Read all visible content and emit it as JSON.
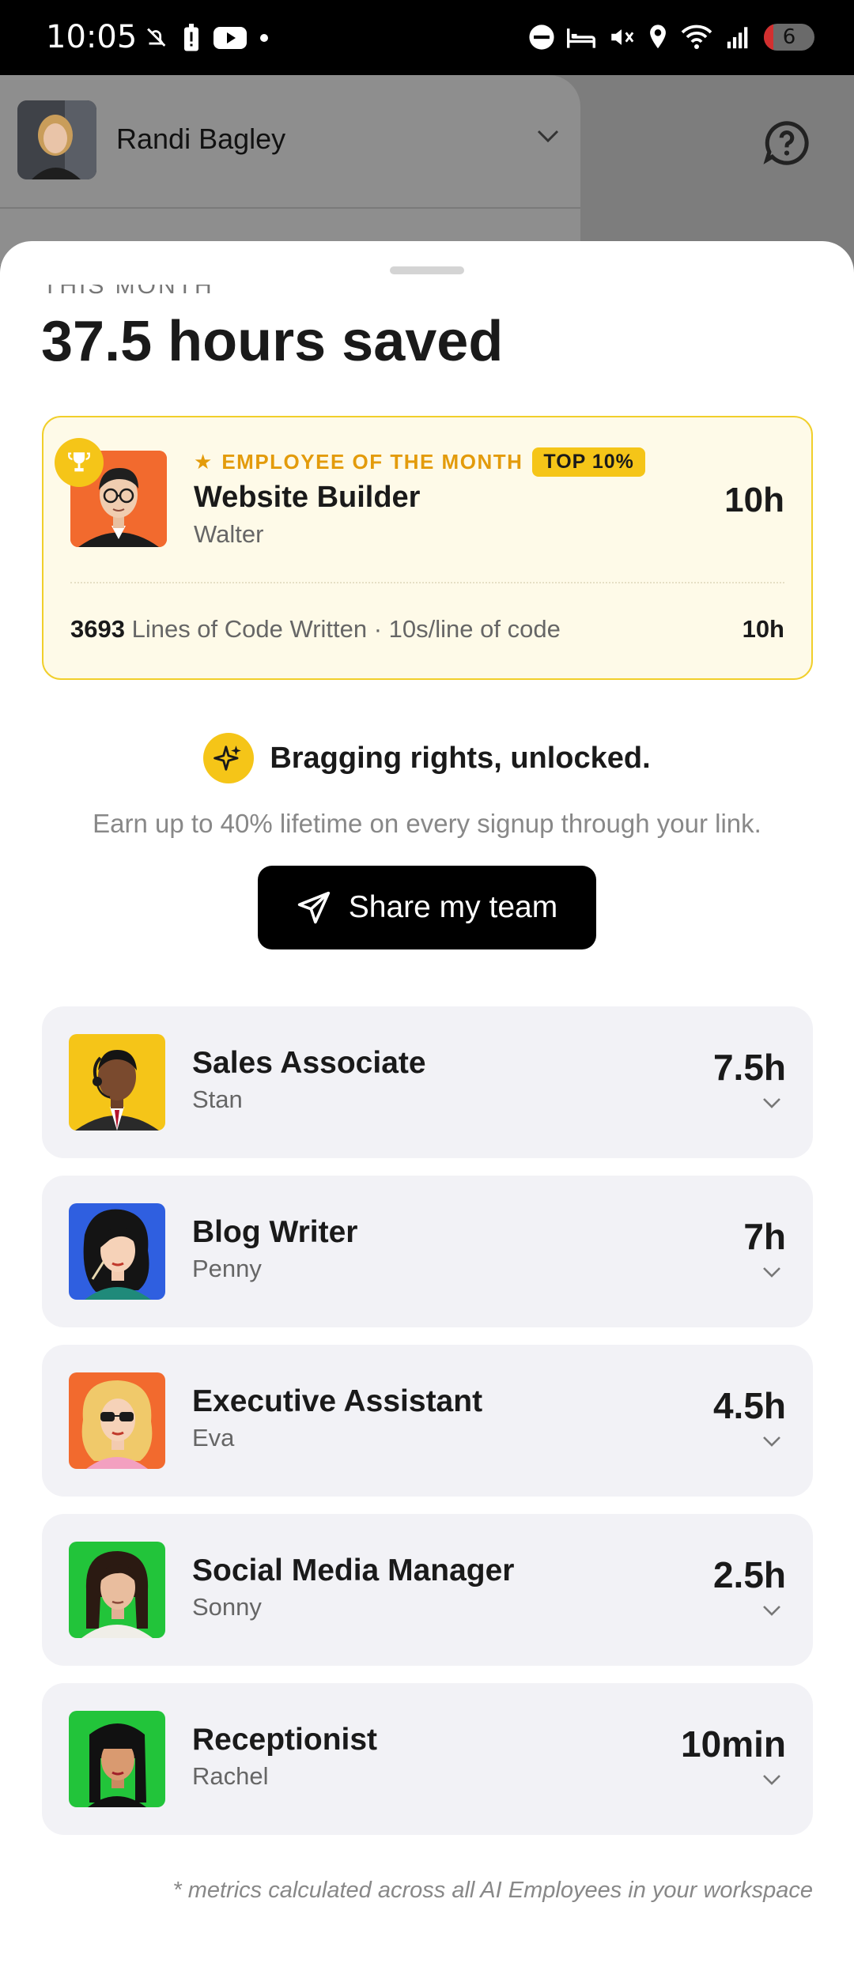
{
  "status_bar": {
    "time": "10:05",
    "signal_label": "6",
    "battery_level": "6"
  },
  "background": {
    "user_name": "Randi Bagley"
  },
  "summary": {
    "period_label": "THIS MONTH",
    "hours_saved": "37.5 hours saved"
  },
  "employee_of_month": {
    "star": "★",
    "label": "EMPLOYEE OF THE MONTH",
    "badge": "TOP 10%",
    "role": "Website Builder",
    "name": "Walter",
    "hours": "10h",
    "metric_count": "3693",
    "metric_text": " Lines of Code Written · 10s/line of code",
    "metric_hours": "10h",
    "avatar_bg": "#f26a2e"
  },
  "bragging": {
    "title": "Bragging rights, unlocked.",
    "subtitle": "Earn up to 40% lifetime on every signup through your link.",
    "share_label": "Share my team"
  },
  "employees": [
    {
      "role": "Sales Associate",
      "name": "Stan",
      "hours": "7.5h",
      "avatar_bg": "#f5c518",
      "icon": "sales-associate-avatar"
    },
    {
      "role": "Blog Writer",
      "name": "Penny",
      "hours": "7h",
      "avatar_bg": "#2f5fe0",
      "icon": "blog-writer-avatar"
    },
    {
      "role": "Executive Assistant",
      "name": "Eva",
      "hours": "4.5h",
      "avatar_bg": "#f26a2e",
      "icon": "executive-assistant-avatar"
    },
    {
      "role": "Social Media Manager",
      "name": "Sonny",
      "hours": "2.5h",
      "avatar_bg": "#22c43a",
      "icon": "social-media-manager-avatar"
    },
    {
      "role": "Receptionist",
      "name": "Rachel",
      "hours": "10min",
      "avatar_bg": "#22c43a",
      "icon": "receptionist-avatar"
    }
  ],
  "footnote": "* metrics calculated across all AI Employees in your workspace"
}
